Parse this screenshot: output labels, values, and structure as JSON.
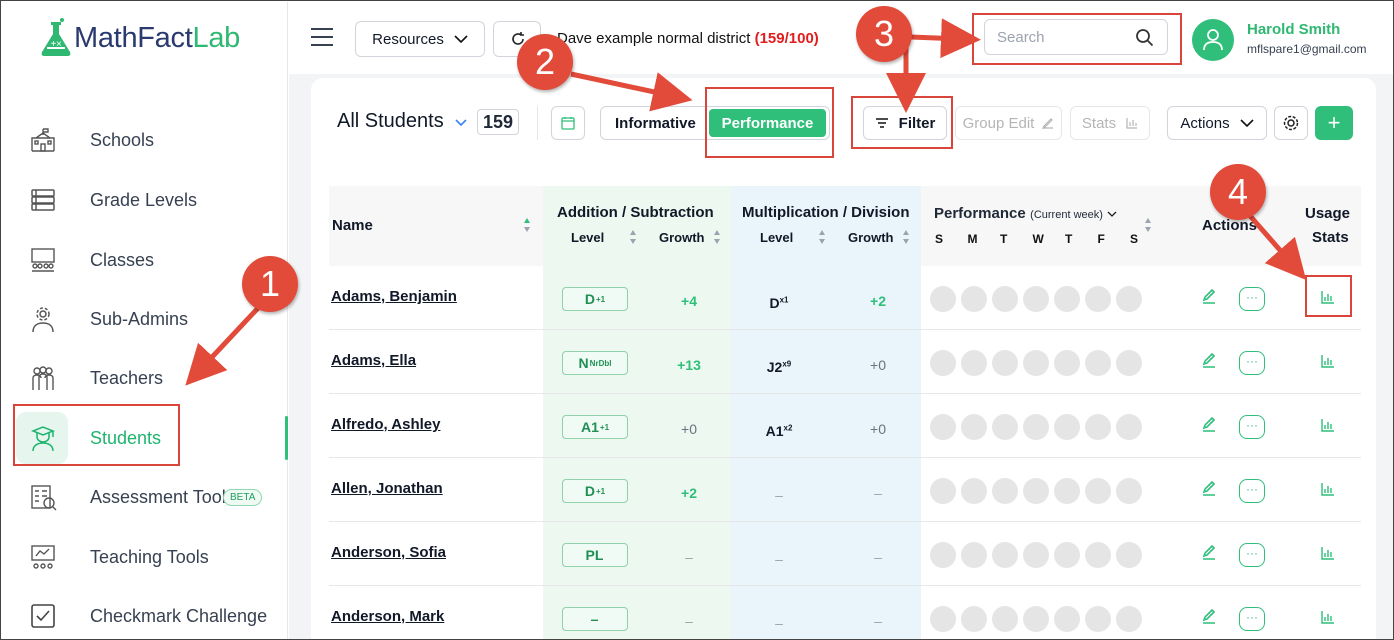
{
  "app": {
    "brand_main": "MathFact",
    "brand_accent": "Lab"
  },
  "sidebar": {
    "items": [
      {
        "label": "Schools",
        "icon": "school-icon"
      },
      {
        "label": "Grade Levels",
        "icon": "list-icon"
      },
      {
        "label": "Classes",
        "icon": "classroom-icon"
      },
      {
        "label": "Sub-Admins",
        "icon": "admin-gear-icon"
      },
      {
        "label": "Teachers",
        "icon": "teachers-icon"
      },
      {
        "label": "Students",
        "icon": "student-icon",
        "active": true
      },
      {
        "label": "Assessment Tool",
        "icon": "assessment-icon",
        "badge": "BETA"
      },
      {
        "label": "Teaching Tools",
        "icon": "teaching-tools-icon"
      },
      {
        "label": "Checkmark Challenge",
        "icon": "checkbox-icon"
      }
    ]
  },
  "topbar": {
    "resources_label": "Resources",
    "district_name": "Dave example normal district",
    "district_count": "(159/100)",
    "search_placeholder": "Search",
    "user_name": "Harold Smith",
    "user_email": "mflspare1@gmail.com"
  },
  "toolbar": {
    "title": "All Students",
    "student_count": "159",
    "informative_label": "Informative",
    "performance_label": "Performance",
    "filter_label": "Filter",
    "group_edit_label": "Group Edit",
    "stats_label": "Stats",
    "actions_label": "Actions",
    "add_label": "+"
  },
  "table": {
    "headers": {
      "name": "Name",
      "add_sub": "Addition / Subtraction",
      "mul_div": "Multiplication / Division",
      "level": "Level",
      "growth": "Growth",
      "performance": "Performance",
      "performance_period": "(Current week)",
      "actions": "Actions",
      "usage_stats_1": "Usage",
      "usage_stats_2": "Stats",
      "days": [
        "S",
        "M",
        "T",
        "W",
        "T",
        "F",
        "S"
      ]
    },
    "rows": [
      {
        "name": "Adams, Benjamin",
        "add_level": "D",
        "add_level_sup": "+1",
        "add_growth": "+4",
        "mul_level": "D",
        "mul_level_sup": "x1",
        "mul_growth": "+2"
      },
      {
        "name": "Adams, Ella",
        "add_level": "N",
        "add_level_sup": "NrDbl",
        "add_growth": "+13",
        "mul_level": "J2",
        "mul_level_sup": "x9",
        "mul_growth": "+0"
      },
      {
        "name": "Alfredo, Ashley",
        "add_level": "A1",
        "add_level_sup": "+1",
        "add_growth": "+0",
        "mul_level": "A1",
        "mul_level_sup": "x2",
        "mul_growth": "+0"
      },
      {
        "name": "Allen, Jonathan",
        "add_level": "D",
        "add_level_sup": "+1",
        "add_growth": "+2",
        "mul_level": "–",
        "mul_level_sup": "",
        "mul_growth": "–"
      },
      {
        "name": "Anderson, Sofia",
        "add_level": "PL",
        "add_level_sup": "",
        "add_growth": "–",
        "mul_level": "–",
        "mul_level_sup": "",
        "mul_growth": "–"
      },
      {
        "name": "Anderson, Mark",
        "add_level": "–",
        "add_level_sup": "",
        "add_growth": "–",
        "mul_level": "–",
        "mul_level_sup": "",
        "mul_growth": "–"
      }
    ]
  },
  "callouts": [
    "1",
    "2",
    "3",
    "4"
  ],
  "colors": {
    "accent": "#2fbf7a",
    "callout": "#e24a3a",
    "alert": "#e11d1d"
  }
}
